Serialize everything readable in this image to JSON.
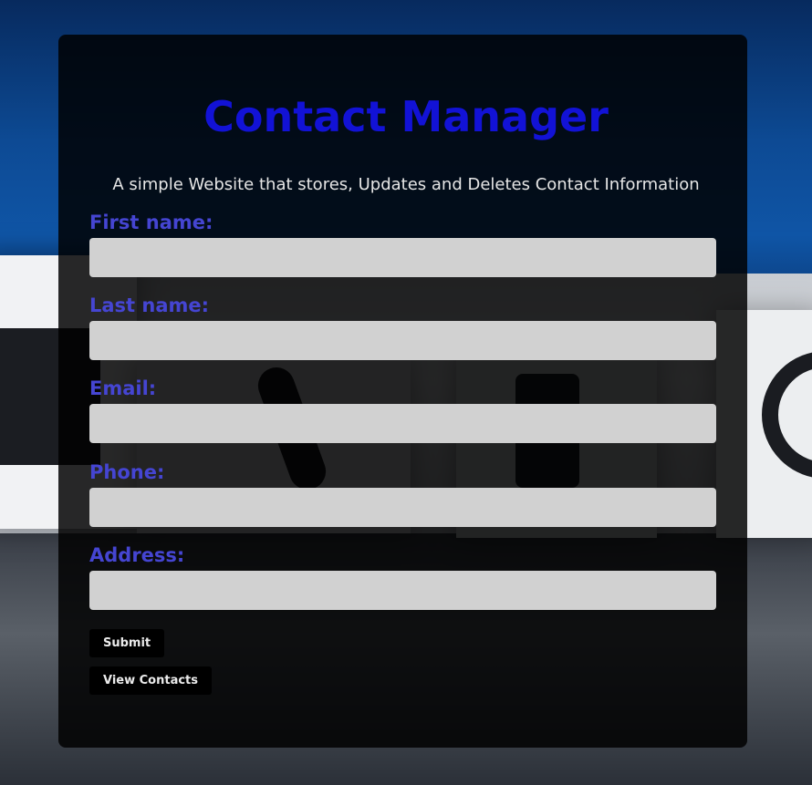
{
  "header": {
    "title": "Contact Manager",
    "subtitle": "A simple Website that stores, Updates and Deletes Contact Information"
  },
  "form": {
    "fields": [
      {
        "label": "First name:",
        "value": "",
        "placeholder": ""
      },
      {
        "label": "Last name:",
        "value": "",
        "placeholder": ""
      },
      {
        "label": "Email:",
        "value": "",
        "placeholder": ""
      },
      {
        "label": "Phone:",
        "value": "",
        "placeholder": ""
      },
      {
        "label": "Address:",
        "value": "",
        "placeholder": ""
      }
    ],
    "submit_label": "Submit",
    "view_contacts_label": "View Contacts"
  },
  "background": {
    "icons": [
      "envelope-icon",
      "phone-handset-icon",
      "mobile-phone-icon",
      "at-sign-icon"
    ]
  },
  "colors": {
    "title": "#1212d6",
    "label": "#4545d2",
    "input_bg": "#d1d1d1",
    "card_bg": "rgba(0,0,0,0.84)",
    "button_bg": "#000000"
  }
}
